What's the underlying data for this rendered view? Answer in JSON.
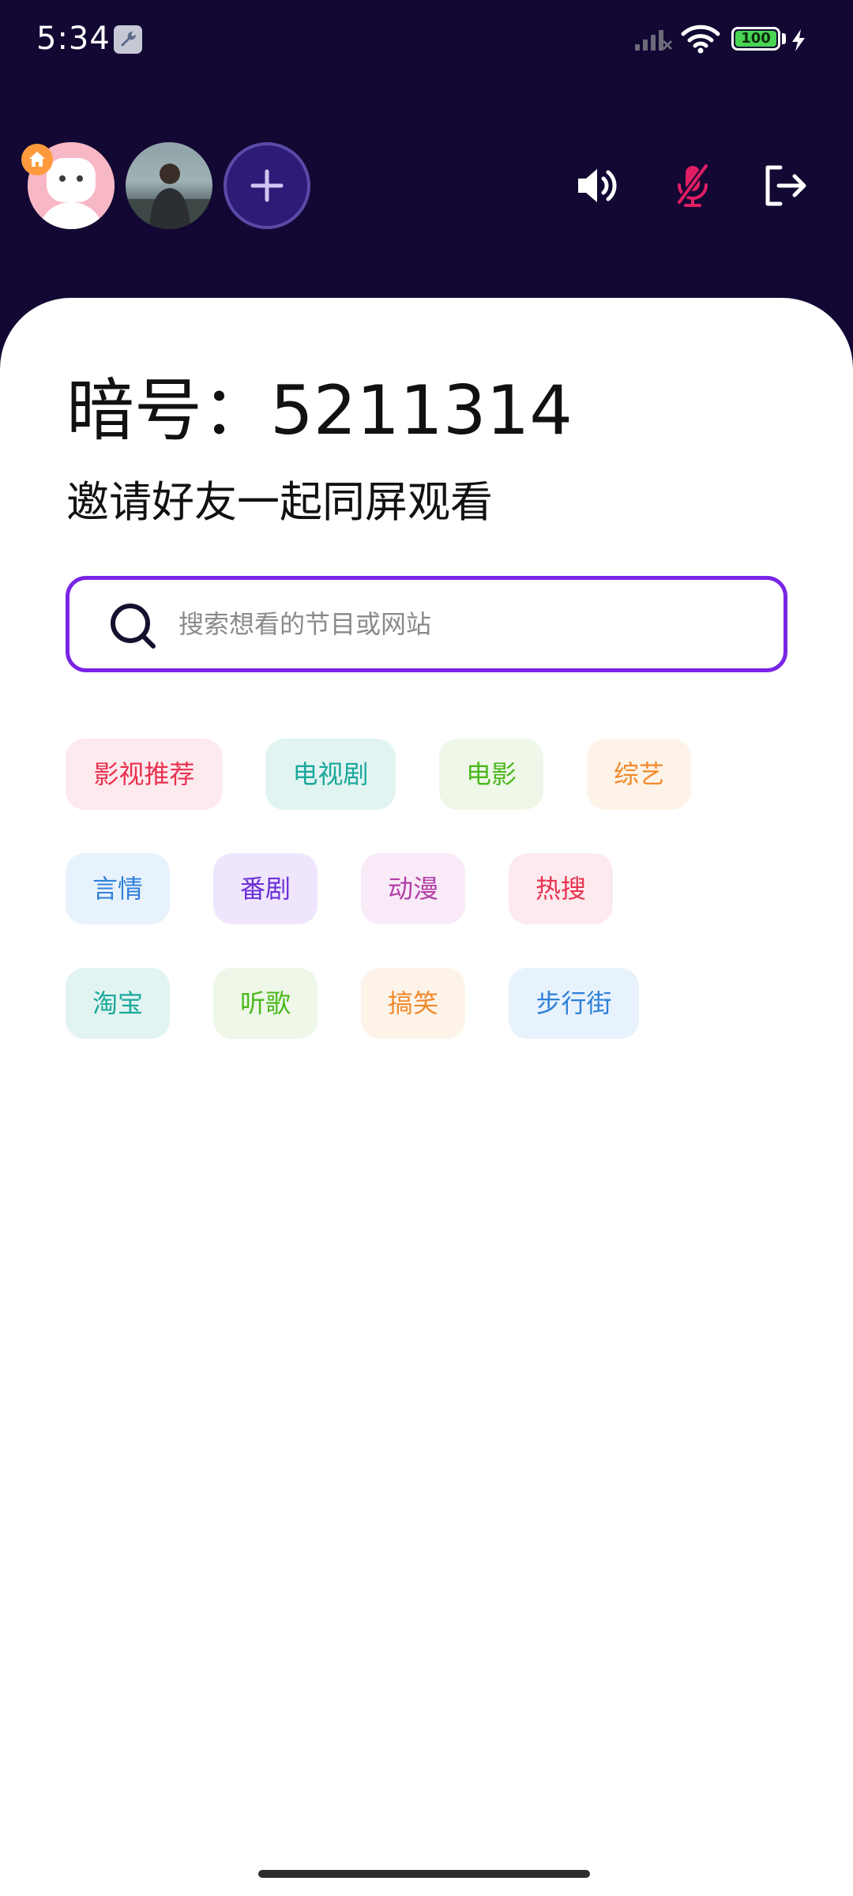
{
  "status_bar": {
    "time": "5:34",
    "battery": "100"
  },
  "room": {
    "code_label": "暗号：",
    "code_value": "5211314",
    "invite_text": "邀请好友一起同屏观看"
  },
  "search": {
    "placeholder": "搜索想看的节目或网站"
  },
  "tags": [
    {
      "label": "影视推荐",
      "color": "#e8324f",
      "bg": "#fdeaee"
    },
    {
      "label": "电视剧",
      "color": "#1aa89a",
      "bg": "#e2f4f2"
    },
    {
      "label": "电影",
      "color": "#4cb81e",
      "bg": "#eef7e8"
    },
    {
      "label": "综艺",
      "color": "#f08a2c",
      "bg": "#fdf3e8"
    },
    {
      "label": "言情",
      "color": "#2f80d8",
      "bg": "#e8f2fd"
    },
    {
      "label": "番剧",
      "color": "#6b2fd6",
      "bg": "#efe6fd"
    },
    {
      "label": "动漫",
      "color": "#b23fa8",
      "bg": "#f8ebf7"
    },
    {
      "label": "热搜",
      "color": "#e8324f",
      "bg": "#fdeaee"
    },
    {
      "label": "淘宝",
      "color": "#1aa89a",
      "bg": "#e2f4f2"
    },
    {
      "label": "听歌",
      "color": "#4cb81e",
      "bg": "#eef7e8"
    },
    {
      "label": "搞笑",
      "color": "#f08a2c",
      "bg": "#fdf3e8"
    },
    {
      "label": "步行街",
      "color": "#2f80d8",
      "bg": "#e8f2fd"
    }
  ],
  "icons": {
    "speaker": "speaker-icon",
    "mic": "mic-muted-icon",
    "exit": "exit-icon",
    "search": "search-icon",
    "add": "plus-icon"
  },
  "colors": {
    "header_bg": "#120833",
    "accent": "#7a24e6",
    "mic_muted": "#e01e64"
  }
}
